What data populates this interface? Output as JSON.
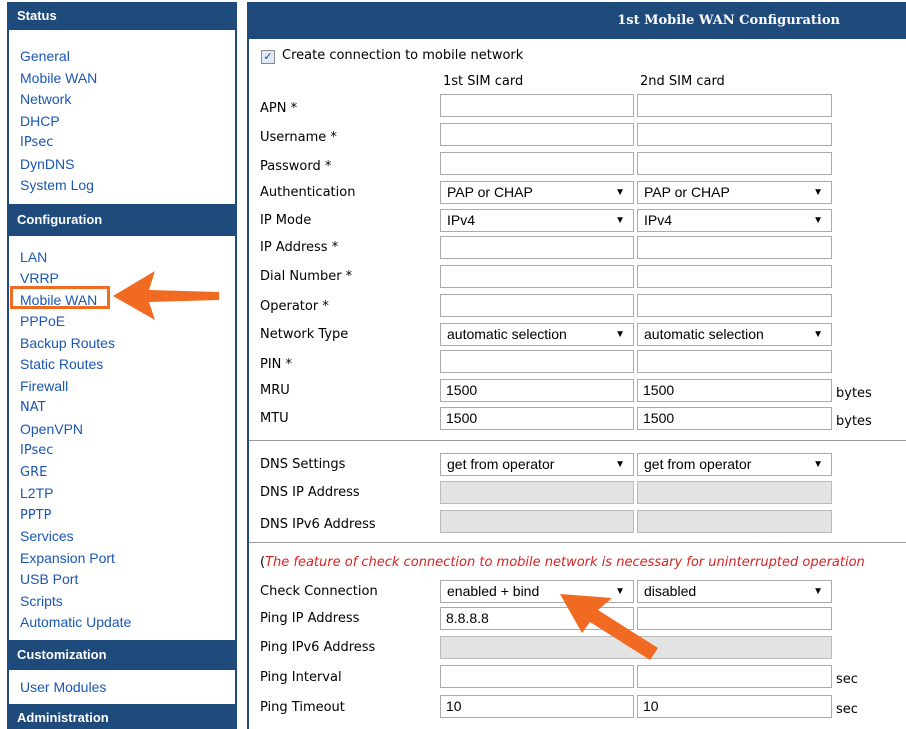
{
  "sidebar": {
    "status_header": "Status",
    "status_items": [
      "General",
      "Mobile WAN",
      "Network",
      "DHCP",
      "IPsec",
      "DynDNS",
      "System Log"
    ],
    "configuration_header": "Configuration",
    "configuration_items": [
      "LAN",
      "VRRP",
      "Mobile WAN",
      "PPPoE",
      "Backup Routes",
      "Static Routes",
      "Firewall",
      "NAT",
      "OpenVPN",
      "IPsec",
      "GRE",
      "L2TP",
      "PPTP",
      "Services",
      "Expansion Port",
      "USB Port",
      "Scripts",
      "Automatic Update"
    ],
    "customization_header": "Customization",
    "customization_items": [
      "User Modules"
    ],
    "administration_header": "Administration"
  },
  "main": {
    "title": "1st Mobile WAN Configuration",
    "create_connection_label": "Create connection to mobile network",
    "create_connection_checked": true,
    "col1_header": "1st SIM card",
    "col2_header": "2nd SIM card",
    "fields": {
      "apn": {
        "label": "APN *",
        "sim1": "",
        "sim2": ""
      },
      "username": {
        "label": "Username *",
        "sim1": "",
        "sim2": ""
      },
      "password": {
        "label": "Password *",
        "sim1": "",
        "sim2": ""
      },
      "authentication": {
        "label": "Authentication",
        "sim1": "PAP or CHAP",
        "sim2": "PAP or CHAP"
      },
      "ip_mode": {
        "label": "IP Mode",
        "sim1": "IPv4",
        "sim2": "IPv4"
      },
      "ip_address": {
        "label": "IP Address *",
        "sim1": "",
        "sim2": ""
      },
      "dial_number": {
        "label": "Dial Number *",
        "sim1": "",
        "sim2": ""
      },
      "operator": {
        "label": "Operator *",
        "sim1": "",
        "sim2": ""
      },
      "network_type": {
        "label": "Network Type",
        "sim1": "automatic selection",
        "sim2": "automatic selection"
      },
      "pin": {
        "label": "PIN *",
        "sim1": "",
        "sim2": ""
      },
      "mru": {
        "label": "MRU",
        "sim1": "1500",
        "sim2": "1500",
        "unit": "bytes"
      },
      "mtu": {
        "label": "MTU",
        "sim1": "1500",
        "sim2": "1500",
        "unit": "bytes"
      },
      "dns_settings": {
        "label": "DNS Settings",
        "sim1": "get from operator",
        "sim2": "get from operator"
      },
      "dns_ip": {
        "label": "DNS IP Address"
      },
      "dns_ipv6": {
        "label": "DNS IPv6 Address"
      },
      "check_connection": {
        "label": "Check Connection",
        "sim1": "enabled + bind",
        "sim2": "disabled"
      },
      "ping_ip": {
        "label": "Ping IP Address",
        "sim1": "8.8.8.8",
        "sim2": ""
      },
      "ping_ipv6": {
        "label": "Ping IPv6 Address"
      },
      "ping_interval": {
        "label": "Ping Interval",
        "sim1": "",
        "sim2": "",
        "unit": "sec"
      },
      "ping_timeout": {
        "label": "Ping Timeout",
        "sim1": "10",
        "sim2": "10",
        "unit": "sec"
      }
    },
    "note_open": "(",
    "note_text": "The feature of check connection to mobile network is necessary for uninterrupted operation"
  },
  "colors": {
    "header_bg": "#1e4a7c",
    "link": "#1a56b3",
    "highlight": "#f06a22",
    "note": "#dd2222"
  }
}
